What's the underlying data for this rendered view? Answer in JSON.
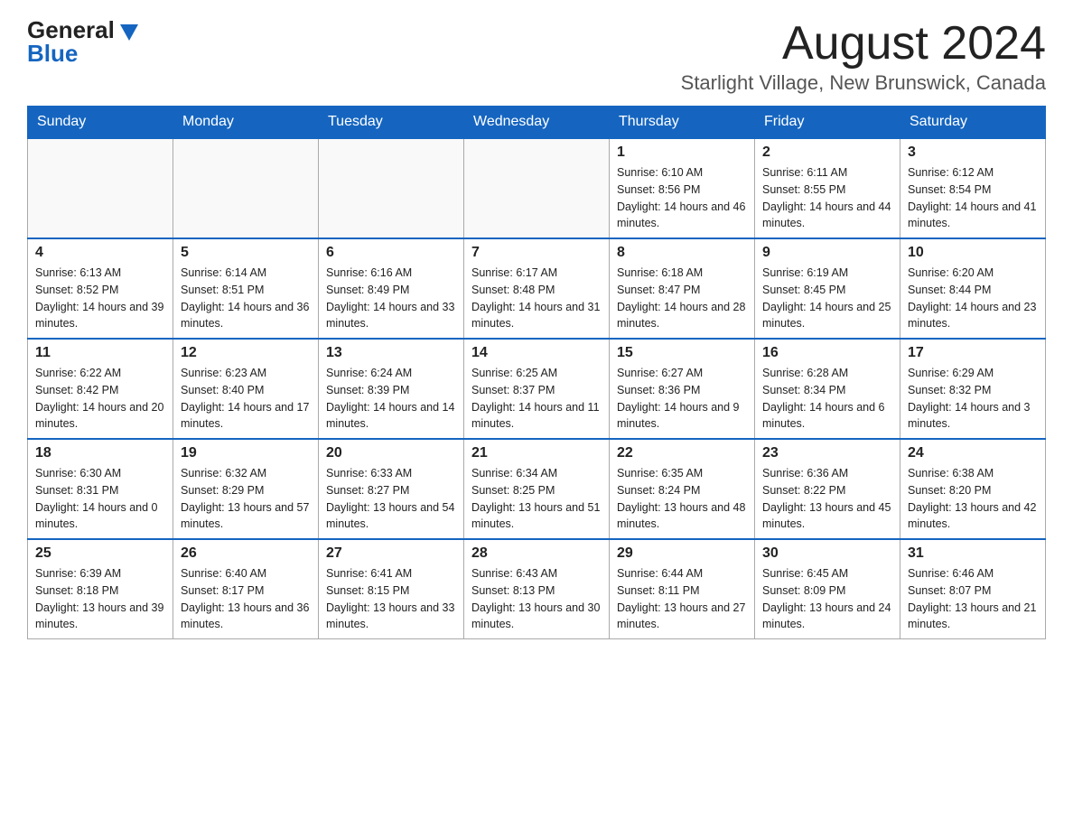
{
  "logo": {
    "general": "General",
    "blue": "Blue"
  },
  "header": {
    "month_title": "August 2024",
    "location": "Starlight Village, New Brunswick, Canada"
  },
  "days_of_week": [
    "Sunday",
    "Monday",
    "Tuesday",
    "Wednesday",
    "Thursday",
    "Friday",
    "Saturday"
  ],
  "weeks": [
    [
      {
        "day": "",
        "info": ""
      },
      {
        "day": "",
        "info": ""
      },
      {
        "day": "",
        "info": ""
      },
      {
        "day": "",
        "info": ""
      },
      {
        "day": "1",
        "info": "Sunrise: 6:10 AM\nSunset: 8:56 PM\nDaylight: 14 hours and 46 minutes."
      },
      {
        "day": "2",
        "info": "Sunrise: 6:11 AM\nSunset: 8:55 PM\nDaylight: 14 hours and 44 minutes."
      },
      {
        "day": "3",
        "info": "Sunrise: 6:12 AM\nSunset: 8:54 PM\nDaylight: 14 hours and 41 minutes."
      }
    ],
    [
      {
        "day": "4",
        "info": "Sunrise: 6:13 AM\nSunset: 8:52 PM\nDaylight: 14 hours and 39 minutes."
      },
      {
        "day": "5",
        "info": "Sunrise: 6:14 AM\nSunset: 8:51 PM\nDaylight: 14 hours and 36 minutes."
      },
      {
        "day": "6",
        "info": "Sunrise: 6:16 AM\nSunset: 8:49 PM\nDaylight: 14 hours and 33 minutes."
      },
      {
        "day": "7",
        "info": "Sunrise: 6:17 AM\nSunset: 8:48 PM\nDaylight: 14 hours and 31 minutes."
      },
      {
        "day": "8",
        "info": "Sunrise: 6:18 AM\nSunset: 8:47 PM\nDaylight: 14 hours and 28 minutes."
      },
      {
        "day": "9",
        "info": "Sunrise: 6:19 AM\nSunset: 8:45 PM\nDaylight: 14 hours and 25 minutes."
      },
      {
        "day": "10",
        "info": "Sunrise: 6:20 AM\nSunset: 8:44 PM\nDaylight: 14 hours and 23 minutes."
      }
    ],
    [
      {
        "day": "11",
        "info": "Sunrise: 6:22 AM\nSunset: 8:42 PM\nDaylight: 14 hours and 20 minutes."
      },
      {
        "day": "12",
        "info": "Sunrise: 6:23 AM\nSunset: 8:40 PM\nDaylight: 14 hours and 17 minutes."
      },
      {
        "day": "13",
        "info": "Sunrise: 6:24 AM\nSunset: 8:39 PM\nDaylight: 14 hours and 14 minutes."
      },
      {
        "day": "14",
        "info": "Sunrise: 6:25 AM\nSunset: 8:37 PM\nDaylight: 14 hours and 11 minutes."
      },
      {
        "day": "15",
        "info": "Sunrise: 6:27 AM\nSunset: 8:36 PM\nDaylight: 14 hours and 9 minutes."
      },
      {
        "day": "16",
        "info": "Sunrise: 6:28 AM\nSunset: 8:34 PM\nDaylight: 14 hours and 6 minutes."
      },
      {
        "day": "17",
        "info": "Sunrise: 6:29 AM\nSunset: 8:32 PM\nDaylight: 14 hours and 3 minutes."
      }
    ],
    [
      {
        "day": "18",
        "info": "Sunrise: 6:30 AM\nSunset: 8:31 PM\nDaylight: 14 hours and 0 minutes."
      },
      {
        "day": "19",
        "info": "Sunrise: 6:32 AM\nSunset: 8:29 PM\nDaylight: 13 hours and 57 minutes."
      },
      {
        "day": "20",
        "info": "Sunrise: 6:33 AM\nSunset: 8:27 PM\nDaylight: 13 hours and 54 minutes."
      },
      {
        "day": "21",
        "info": "Sunrise: 6:34 AM\nSunset: 8:25 PM\nDaylight: 13 hours and 51 minutes."
      },
      {
        "day": "22",
        "info": "Sunrise: 6:35 AM\nSunset: 8:24 PM\nDaylight: 13 hours and 48 minutes."
      },
      {
        "day": "23",
        "info": "Sunrise: 6:36 AM\nSunset: 8:22 PM\nDaylight: 13 hours and 45 minutes."
      },
      {
        "day": "24",
        "info": "Sunrise: 6:38 AM\nSunset: 8:20 PM\nDaylight: 13 hours and 42 minutes."
      }
    ],
    [
      {
        "day": "25",
        "info": "Sunrise: 6:39 AM\nSunset: 8:18 PM\nDaylight: 13 hours and 39 minutes."
      },
      {
        "day": "26",
        "info": "Sunrise: 6:40 AM\nSunset: 8:17 PM\nDaylight: 13 hours and 36 minutes."
      },
      {
        "day": "27",
        "info": "Sunrise: 6:41 AM\nSunset: 8:15 PM\nDaylight: 13 hours and 33 minutes."
      },
      {
        "day": "28",
        "info": "Sunrise: 6:43 AM\nSunset: 8:13 PM\nDaylight: 13 hours and 30 minutes."
      },
      {
        "day": "29",
        "info": "Sunrise: 6:44 AM\nSunset: 8:11 PM\nDaylight: 13 hours and 27 minutes."
      },
      {
        "day": "30",
        "info": "Sunrise: 6:45 AM\nSunset: 8:09 PM\nDaylight: 13 hours and 24 minutes."
      },
      {
        "day": "31",
        "info": "Sunrise: 6:46 AM\nSunset: 8:07 PM\nDaylight: 13 hours and 21 minutes."
      }
    ]
  ]
}
